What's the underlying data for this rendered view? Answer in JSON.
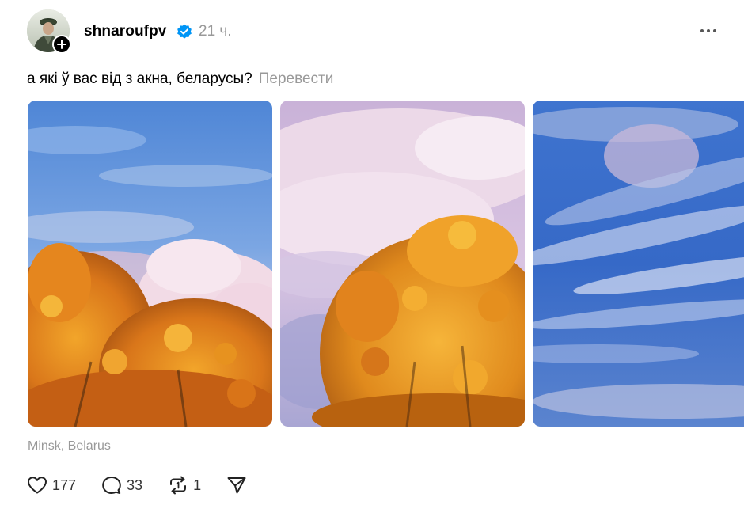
{
  "post": {
    "username": "shnaroufpv",
    "timestamp": "21 ч.",
    "caption": "а які ў вас від з акна, беларусы?",
    "translate_label": "Перевести",
    "location": "Minsk, Belarus"
  },
  "actions": {
    "likes": "177",
    "comments": "33",
    "reposts": "1"
  },
  "icons": {
    "verified": "verified-badge-icon",
    "more": "more-options-icon",
    "like": "heart-icon",
    "comment": "comment-bubble-icon",
    "repost": "repost-icon",
    "share": "send-icon",
    "follow": "plus-icon"
  },
  "colors": {
    "verified_blue": "#0095f6",
    "muted_text": "#999999"
  }
}
